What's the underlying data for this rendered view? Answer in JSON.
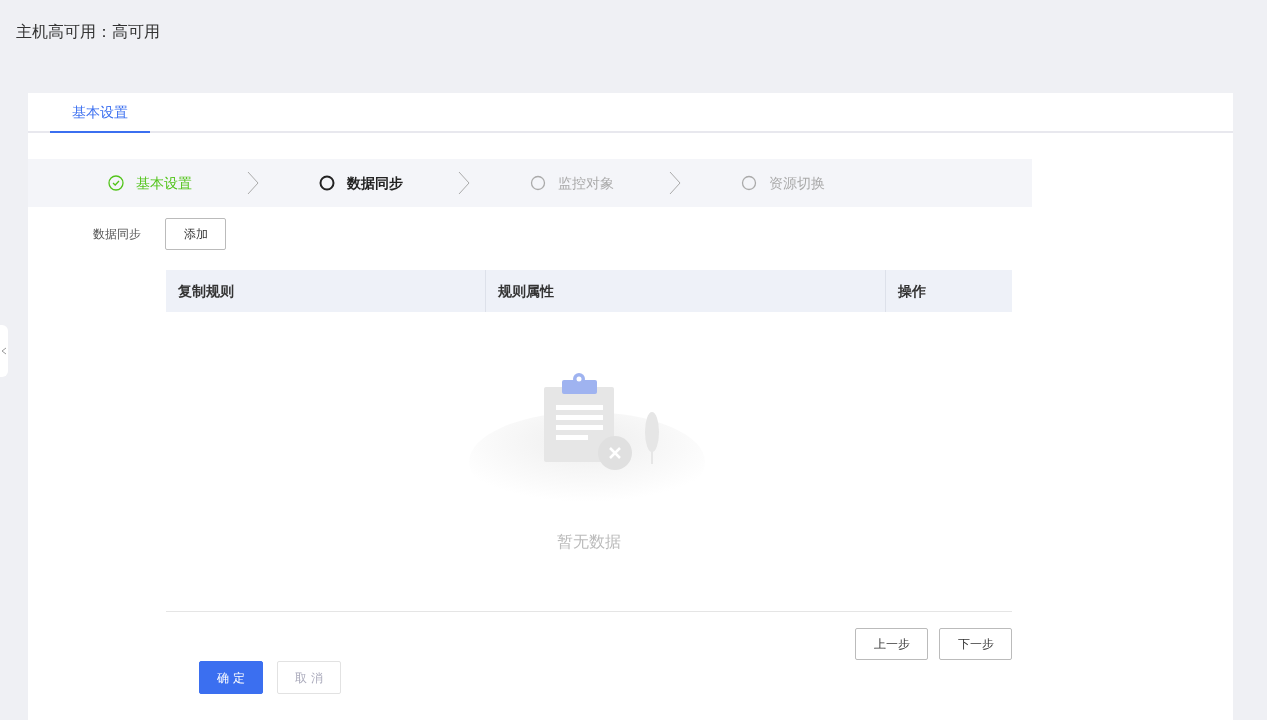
{
  "page_title": "主机高可用：高可用",
  "tabs": [
    {
      "label": "基本设置",
      "selected": true
    }
  ],
  "steps": [
    {
      "label": "基本设置",
      "finished": true,
      "selected": false
    },
    {
      "label": "数据同步",
      "finished": false,
      "selected": true
    },
    {
      "label": "监控对象",
      "finished": false,
      "selected": false
    },
    {
      "label": "资源切换",
      "finished": false,
      "selected": false
    }
  ],
  "form": {
    "label": "数据同步",
    "add_button": "添加"
  },
  "table": {
    "columns": [
      "复制规则",
      "规则属性",
      "操作"
    ],
    "empty_text": "暂无数据"
  },
  "step_buttons": [
    "上一步",
    "下一步"
  ],
  "footer_buttons": [
    {
      "label": "确 定",
      "kind": "primary",
      "disabled": false
    },
    {
      "label": "取 消",
      "kind": "default",
      "disabled": true
    }
  ]
}
